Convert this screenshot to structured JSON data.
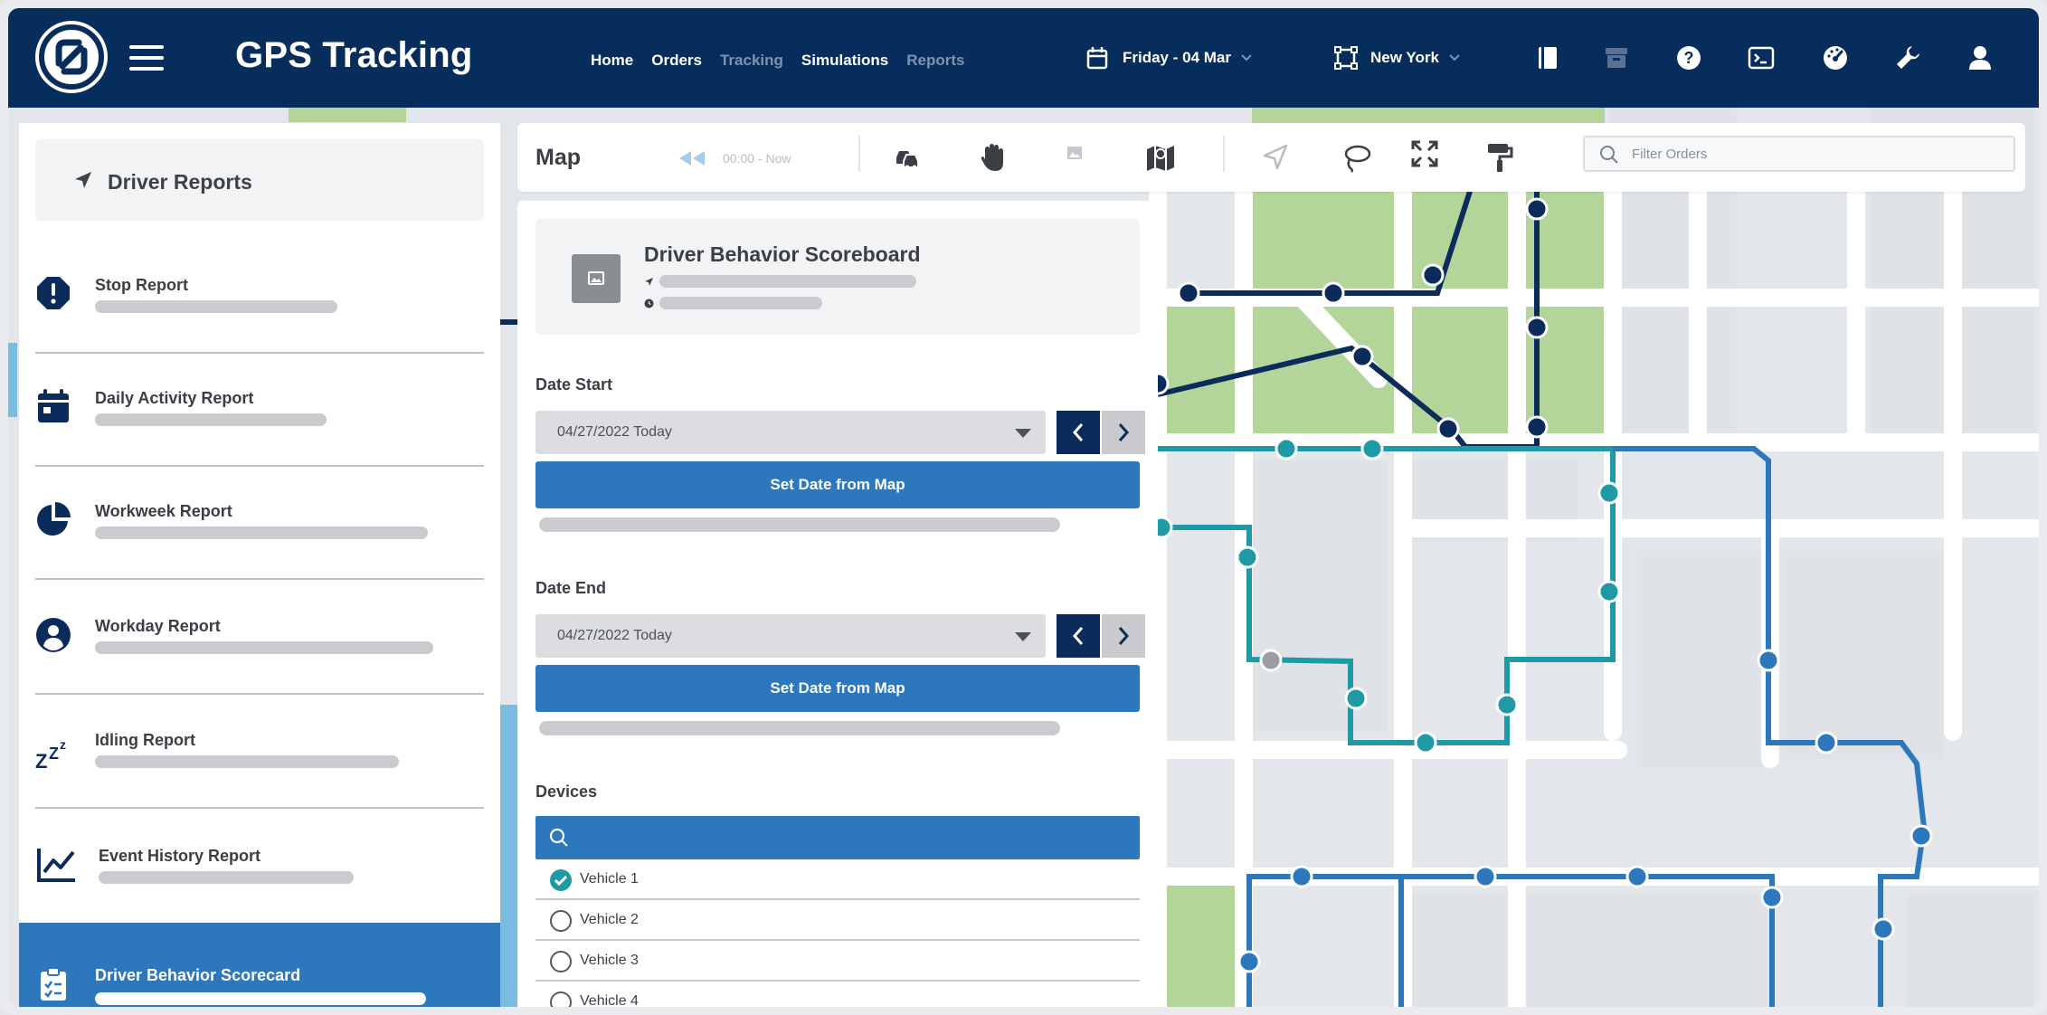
{
  "app": {
    "title": "GPS Tracking",
    "nav": [
      "Home",
      "Orders",
      "Tracking",
      "Simulations",
      "Reports"
    ],
    "date_label": "Friday - 04 Mar",
    "city_label": "New York"
  },
  "sidebar": {
    "header": "Driver Reports",
    "items": [
      {
        "label": "Stop Report",
        "icon": "alert-octagon-icon"
      },
      {
        "label": "Daily Activity Report",
        "icon": "calendar-icon"
      },
      {
        "label": "Workweek Report",
        "icon": "pie-chart-icon"
      },
      {
        "label": "Workday Report",
        "icon": "user-circle-icon"
      },
      {
        "label": "Idling Report",
        "icon": "sleep-zzz-icon"
      },
      {
        "label": "Event History Report",
        "icon": "line-chart-icon"
      }
    ],
    "active_item": {
      "label": "Driver Behavior Scorecard",
      "icon": "clipboard-check-icon"
    }
  },
  "map_toolbar": {
    "title": "Map",
    "time_range": "00:00 - Now",
    "filter_placeholder": "Filter Orders"
  },
  "panel": {
    "card_title": "Driver Behavior Scoreboard",
    "date_start_label": "Date Start",
    "date_start_value": "04/27/2022 Today",
    "date_end_label": "Date End",
    "date_end_value": "04/27/2022 Today",
    "set_date_button": "Set Date from Map",
    "devices_label": "Devices",
    "devices": [
      {
        "label": "Vehicle 1",
        "checked": true
      },
      {
        "label": "Vehicle 2",
        "checked": false
      },
      {
        "label": "Vehicle 3",
        "checked": false
      },
      {
        "label": "Vehicle 4",
        "checked": false
      }
    ]
  },
  "colors": {
    "topbar": "#062d5b",
    "accent_blue": "#2d77bd",
    "route_navy": "#0b2c5a",
    "route_teal": "#1f9aa4",
    "route_blue": "#2d77bd",
    "park_green": "#b4d59a"
  }
}
